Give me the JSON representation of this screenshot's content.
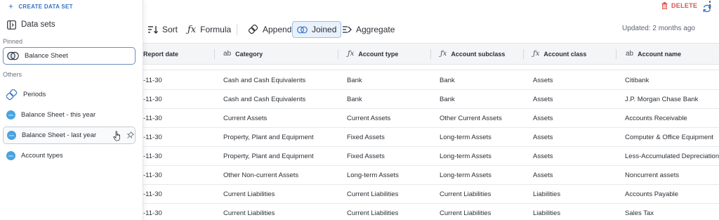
{
  "header": {
    "delete_label": "DELETE"
  },
  "toolbar": {
    "sort_label": "Sort",
    "formula_label": "Formula",
    "append_label": "Append",
    "joined_label": "Joined",
    "aggregate_label": "Aggregate",
    "updated_text": "Updated: 2 months ago"
  },
  "table": {
    "columns": [
      {
        "type_icon": "",
        "label": "Report date"
      },
      {
        "type_icon": "ab",
        "label": "Category"
      },
      {
        "type_icon": "fx",
        "label": "Account type"
      },
      {
        "type_icon": "fx",
        "label": "Account subclass"
      },
      {
        "type_icon": "fx",
        "label": "Account class"
      },
      {
        "type_icon": "ab",
        "label": "Account name"
      }
    ],
    "rows": [
      {
        "date": "-11-30",
        "category": "Cash and Cash Equivalents",
        "type": "Bank",
        "subclass": "Bank",
        "class": "Assets",
        "name": "Citibank"
      },
      {
        "date": "-11-30",
        "category": "Cash and Cash Equivalents",
        "type": "Bank",
        "subclass": "Bank",
        "class": "Assets",
        "name": "J.P. Morgan Chase Bank"
      },
      {
        "date": "-11-30",
        "category": "Current Assets",
        "type": "Current Assets",
        "subclass": "Other Current Assets",
        "class": "Assets",
        "name": "Accounts Receivable"
      },
      {
        "date": "-11-30",
        "category": "Property, Plant and Equipment",
        "type": "Fixed Assets",
        "subclass": "Long-term Assets",
        "class": "Assets",
        "name": "Computer & Office Equipment"
      },
      {
        "date": "-11-30",
        "category": "Property, Plant and Equipment",
        "type": "Fixed Assets",
        "subclass": "Long-term Assets",
        "class": "Assets",
        "name": "Less-Accumulated Depreciation:"
      },
      {
        "date": "-11-30",
        "category": "Other Non-current Assets",
        "type": "Long-term Assets",
        "subclass": "Long-term Assets",
        "class": "Assets",
        "name": "Noncurrent assets"
      },
      {
        "date": "-11-30",
        "category": "Current Liabilities",
        "type": "Current Liabilities",
        "subclass": "Current Liabilities",
        "class": "Liabilities",
        "name": "Accounts Payable"
      },
      {
        "date": "-11-30",
        "category": "Current Liabilities",
        "type": "Current Liabilities",
        "subclass": "Current Liabilities",
        "class": "Liabilities",
        "name": "Sales Tax"
      }
    ]
  },
  "sidebar": {
    "create_label": "CREATE DATA SET",
    "title": "Data sets",
    "pinned_label": "Pinned",
    "others_label": "Others",
    "pinned": [
      {
        "label": "Balance Sheet",
        "icon": "joined-icon"
      }
    ],
    "others": [
      {
        "label": "Periods",
        "icon": "append-icon"
      },
      {
        "label": "Balance Sheet - this year",
        "icon": "xero-icon",
        "icon_text": "xero"
      },
      {
        "label": "Balance Sheet - last year",
        "icon": "xero-icon",
        "icon_text": "xero"
      },
      {
        "label": "Account types",
        "icon": "xero-icon",
        "icon_text": "xero"
      }
    ]
  },
  "colors": {
    "accent": "#3573c4",
    "danger": "#d9534f",
    "active_tab_bg": "#e9f1fb",
    "xero_blue": "#4aa3df"
  }
}
